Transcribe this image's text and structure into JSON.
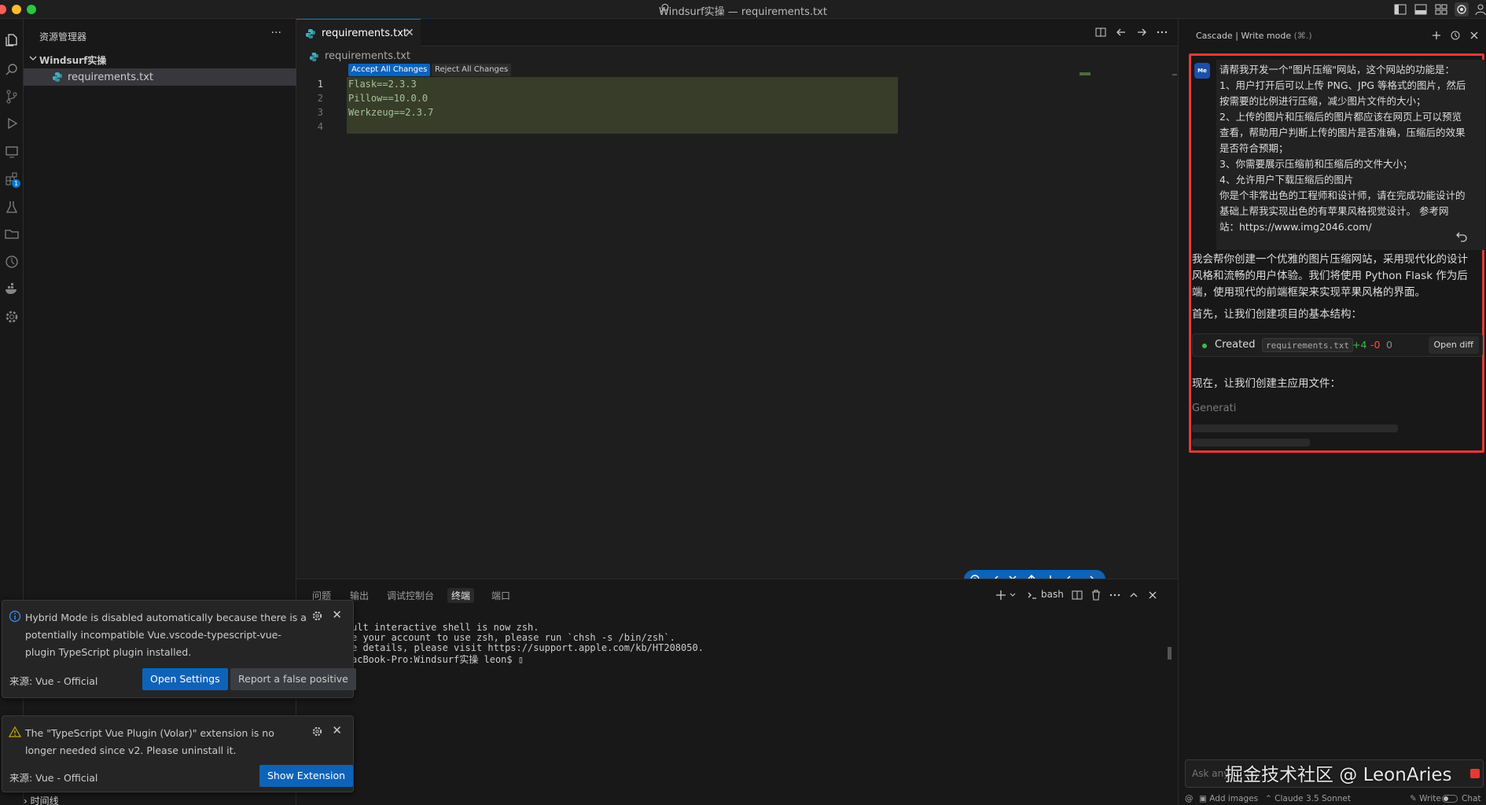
{
  "window": {
    "title": "Windsurf实操 — requirements.txt",
    "traffic_lights": [
      "#ff5f57",
      "#febc2e",
      "#28c840"
    ]
  },
  "activity_bar": {
    "icons": [
      "files-icon",
      "search-icon",
      "source-control-icon",
      "run-debug-icon",
      "remote-explorer-icon",
      "extensions-icon",
      "testing-icon",
      "folder-icon",
      "timeline-icon",
      "docker-icon",
      "settings-gear-icon"
    ],
    "extensions_badge": "1"
  },
  "sidebar": {
    "title": "资源管理器",
    "more": "···",
    "folder": "Windsurf实操",
    "files": [
      {
        "name": "requirements.txt"
      }
    ],
    "bottom_section": "时间线"
  },
  "editor": {
    "tab": {
      "label": "requirements.txt",
      "close": "✕"
    },
    "breadcrumb": "requirements.txt",
    "accept_all": "Accept All Changes",
    "reject_all": "Reject All Changes",
    "lines": [
      {
        "num": "1",
        "text": "Flask==2.3.3"
      },
      {
        "num": "2",
        "text": "Pillow==10.0.0"
      },
      {
        "num": "3",
        "text": "Werkzeug==2.3.7"
      },
      {
        "num": "4",
        "text": ""
      }
    ]
  },
  "panel": {
    "tabs": [
      "问题",
      "输出",
      "调试控制台",
      "终端",
      "端口"
    ],
    "active_tab": "终端",
    "shell": "bash",
    "terminal_lines": [
      "ult interactive shell is now zsh.",
      "e your account to use zsh, please run `chsh -s /bin/zsh`.",
      "e details, please visit https://support.apple.com/kb/HT208050.",
      "acBook-Pro:Windsurf实操 leon$ ▯"
    ]
  },
  "notifications": [
    {
      "type": "info",
      "message": "Hybrid Mode is disabled automatically because there is a potentially incompatible Vue.vscode-typescript-vue-plugin TypeScript plugin installed.",
      "source": "来源: Vue - Official",
      "primary": "Open Settings",
      "secondary": "Report a false positive"
    },
    {
      "type": "warning",
      "message": "The \"TypeScript Vue Plugin (Volar)\" extension is no longer needed since v2. Please uninstall it.",
      "source": "来源: Vue - Official",
      "primary": "Show Extension"
    }
  ],
  "cascade": {
    "title": "Cascade | Write mode",
    "shortcut": "(⌘.)",
    "user_avatar": "Me",
    "user_message_lines": [
      "请帮我开发一个\"图片压缩\"网站，这个网站的功能是：",
      "1、用户打开后可以上传 PNG、JPG 等格式的图片，然后",
      "按需要的比例进行压缩，减少图片文件的大小；",
      "2、上传的图片和压缩后的图片都应该在网页上可以预览",
      "查看，帮助用户判断上传的图片是否准确，压缩后的效果",
      "是否符合预期；",
      "3、你需要展示压缩前和压缩后的文件大小；",
      "4、允许用户下载压缩后的图片",
      "你是个非常出色的工程师和设计师，请在完成功能设计的",
      "基础上帮我实现出色的有苹果风格视觉设计。 参考网",
      "站：https://www.img2046.com/"
    ],
    "ai_lines": [
      "我会帮你创建一个优雅的图片压缩网站，采用现代化的设计",
      "风格和流畅的用户体验。我们将使用 Python Flask 作为后",
      "端，使用现代的前端框架来实现苹果风格的界面。"
    ],
    "ai_step1": "首先，让我们创建项目的基本结构：",
    "created": {
      "label": "Created",
      "file": "requirements.txt",
      "plus": "+4",
      "minus": "-0",
      "zero": "0",
      "open_diff": "Open diff"
    },
    "ai_step2": "现在，让我们创建主应用文件：",
    "generating": "Generati",
    "input_placeholder": "Ask any",
    "watermark": "掘金技术社区 @ LeonAries",
    "footer": {
      "add_images": "Add images",
      "model": "Claude 3.5 Sonnet",
      "write": "Write",
      "chat": "Chat"
    },
    "highlight_color": "#e53935"
  }
}
